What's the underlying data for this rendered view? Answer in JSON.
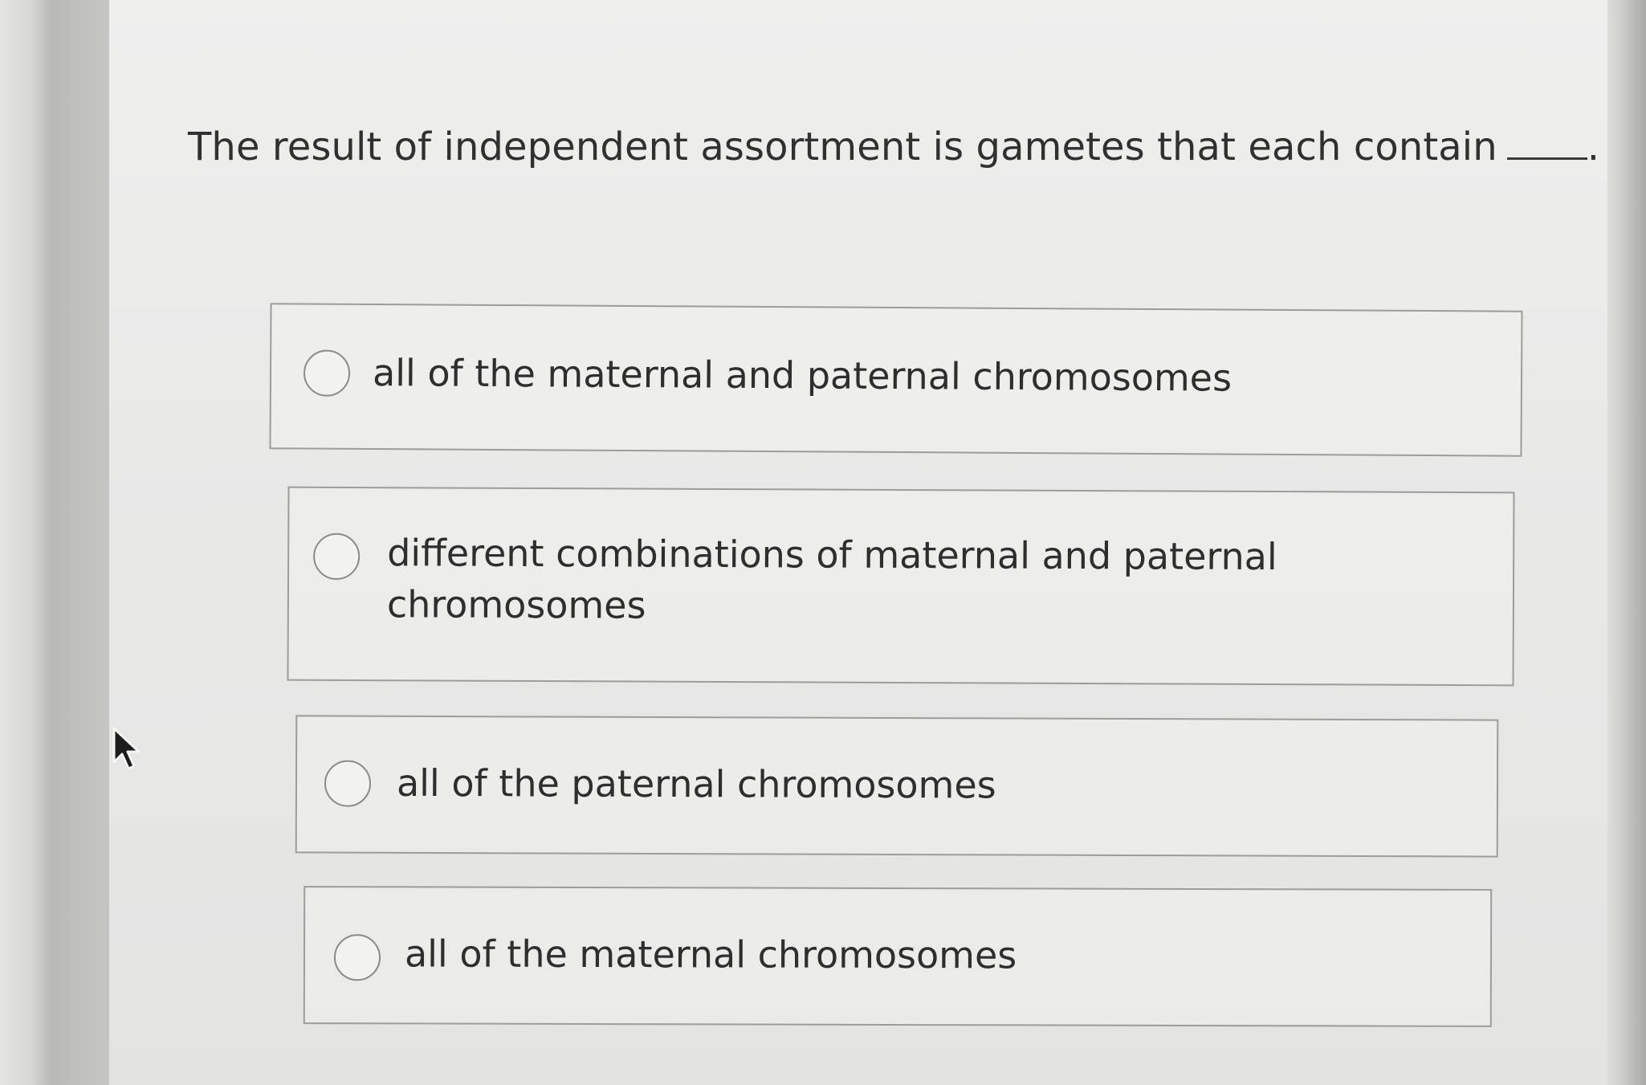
{
  "question": {
    "text": "The result of independent assortment is gametes that each contain",
    "blank_suffix": "."
  },
  "options": [
    {
      "label": "all of the maternal and paternal chromosomes",
      "selected": false
    },
    {
      "label": "different combinations of maternal and paternal",
      "label_line2": "chromosomes",
      "selected": false
    },
    {
      "label": "all of the paternal chromosomes",
      "selected": false
    },
    {
      "label": "all of the maternal chromosomes",
      "selected": false
    }
  ],
  "icons": {
    "radio": "radio-button-icon",
    "cursor": "mouse-pointer-icon"
  }
}
